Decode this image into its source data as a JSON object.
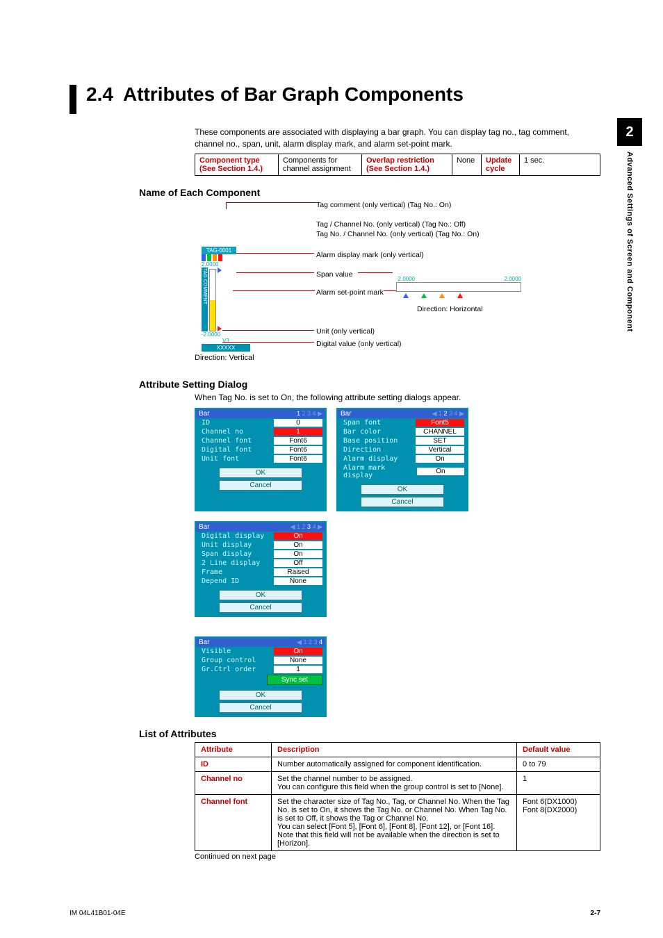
{
  "sideTab": {
    "num": "2",
    "text": "Advanced Settings of Screen and Component"
  },
  "heading": {
    "num": "2.4",
    "title": "Attributes of Bar Graph Components"
  },
  "intro": "These components are associated with displaying a bar graph. You can display tag no., tag comment, channel no., span, unit, alarm display mark, and alarm set-point mark.",
  "metaTable": {
    "h1": "Component type",
    "h1b": "(See Section 1.4.)",
    "v1a": "Components for",
    "v1b": "channel assignment",
    "h2": "Overlap restriction",
    "h2b": "(See Section 1.4.)",
    "v2": "None",
    "h3": "Update",
    "h3b": "cycle",
    "v3": "1 sec."
  },
  "sections": {
    "name": "Name of Each Component",
    "attr": "Attribute Setting Dialog",
    "attrNote": "When Tag No. is set to On, the following attribute setting dialogs appear.",
    "list": "List of Attributes"
  },
  "diagram": {
    "tagComment": "Tag comment (only vertical) (Tag No.: On)",
    "tagChA": "Tag / Channel No. (only vertical) (Tag No.: Off)",
    "tagChB": "Tag No. / Channel No. (only vertical) (Tag No.: On)",
    "alarmMark": "Alarm display mark (only vertical)",
    "span": "Span value",
    "spanLo": "-2.0000",
    "spanHi": "2.0000",
    "alarmSet": "Alarm set-point mark",
    "dirH": "Direction: Horizontal",
    "unit": "Unit (only vertical)",
    "digital": "Digital value (only vertical)",
    "dirV": "Direction: Vertical",
    "tagLabel": "TAG-0001",
    "unitLabel": "V3",
    "digitalLabel": "XXXXX"
  },
  "dialogs": [
    {
      "title": "Bar",
      "pageOn": "1",
      "pageRest": "2 3 4 ▶",
      "rows": [
        {
          "lbl": "ID",
          "val": "0"
        },
        {
          "lbl": "Channel no",
          "val": "1",
          "cls": "red"
        },
        {
          "lbl": "Channel font",
          "val": "Font6"
        },
        {
          "lbl": "Digital font",
          "val": "Font6"
        },
        {
          "lbl": "Unit font",
          "val": "Font6"
        }
      ],
      "btns": [
        "OK",
        "Cancel"
      ]
    },
    {
      "title": "Bar",
      "pagePre": "◀ 1",
      "pageOn": "2",
      "pageRest": "3 4 ▶",
      "rows": [
        {
          "lbl": "Span font",
          "val": "Font5",
          "cls": "red"
        },
        {
          "lbl": "Bar color",
          "val": "CHANNEL"
        },
        {
          "lbl": "Base position",
          "val": "SET"
        },
        {
          "lbl": "Direction",
          "val": "Vertical"
        },
        {
          "lbl": "Alarm display",
          "val": "On"
        },
        {
          "lbl": "Alarm mark display",
          "val": "On"
        }
      ],
      "btns": [
        "OK",
        "Cancel"
      ]
    },
    {
      "title": "Bar",
      "pagePre": "◀ 1 2",
      "pageOn": "3",
      "pageRest": "4 ▶",
      "rows": [
        {
          "lbl": "Digital display",
          "val": "On",
          "cls": "red"
        },
        {
          "lbl": "Unit display",
          "val": "On"
        },
        {
          "lbl": "Span display",
          "val": "On"
        },
        {
          "lbl": "2 Line display",
          "val": "Off"
        },
        {
          "lbl": "Frame",
          "val": "Raised"
        },
        {
          "lbl": "Depend ID",
          "val": "None"
        }
      ],
      "btns": [
        "OK",
        "Cancel"
      ]
    },
    {
      "title": "Bar",
      "pagePre": "◀ 1 2 3",
      "pageOn": "4",
      "pageRest": "",
      "rows": [
        {
          "lbl": "Visible",
          "val": "On",
          "cls": "red"
        },
        {
          "lbl": "Group control",
          "val": "None"
        },
        {
          "lbl": "Gr.Ctrl order",
          "val": "1"
        }
      ],
      "extraBtn": "Sync set",
      "btns": [
        "OK",
        "Cancel"
      ]
    }
  ],
  "attrTable": {
    "headers": [
      "Attribute",
      "Description",
      "Default value"
    ],
    "rows": [
      {
        "name": "ID",
        "desc": "Number automatically assigned for component identification.",
        "def": "0 to 79"
      },
      {
        "name": "Channel no",
        "desc": "Set the channel number to be assigned.\nYou can configure this field when the group control is set to [None].",
        "def": "1"
      },
      {
        "name": "Channel font",
        "desc": "Set the character size of Tag No., Tag, or Channel No. When the Tag No. is set to On, it shows the Tag No. or Channel No. When Tag No. is set to Off, it shows the Tag or Channel No.\nYou can select [Font 5], [Font 6], [Font 8], [Font 12], or [Font 16].\nNote that this field will not be available when the direction is set to [Horizon].",
        "def": "Font 6(DX1000)\nFont 8(DX2000)"
      }
    ],
    "continued": "Continued on next page"
  },
  "footer": {
    "left": "IM 04L41B01-04E",
    "right": "2-7"
  }
}
